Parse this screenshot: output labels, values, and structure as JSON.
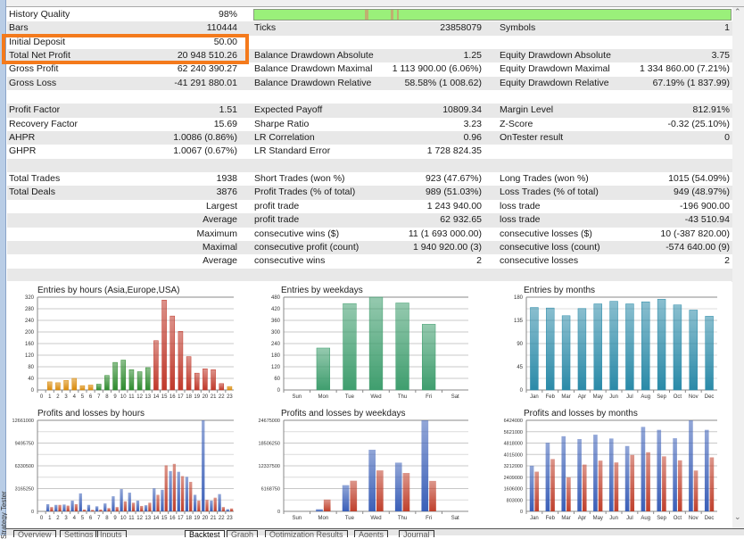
{
  "sidebar_tab": "Strategy Tester",
  "history_quality_bar": {
    "fill_percent": 98,
    "color": "#9af07a"
  },
  "stats": [
    [
      [
        "History Quality",
        "98%"
      ],
      [
        "",
        ""
      ],
      [
        "",
        ""
      ]
    ],
    [
      [
        "Bars",
        "110444"
      ],
      [
        "Ticks",
        "23858079"
      ],
      [
        "Symbols",
        "1"
      ]
    ],
    [
      [
        "Initial Deposit",
        "50.00"
      ],
      [
        "",
        ""
      ],
      [
        "",
        ""
      ]
    ],
    [
      [
        "Total Net Profit",
        "20 948 510.26"
      ],
      [
        "Balance Drawdown Absolute",
        "1.25"
      ],
      [
        "Equity Drawdown Absolute",
        "3.75"
      ]
    ],
    [
      [
        "Gross Profit",
        "62 240 390.27"
      ],
      [
        "Balance Drawdown Maximal",
        "1 113 900.00 (6.06%)"
      ],
      [
        "Equity Drawdown Maximal",
        "1 334 860.00 (7.21%)"
      ]
    ],
    [
      [
        "Gross Loss",
        "-41 291 880.01"
      ],
      [
        "Balance Drawdown Relative",
        "58.58% (1 008.62)"
      ],
      [
        "Equity Drawdown Relative",
        "67.19% (1 837.99)"
      ]
    ],
    [
      [
        "",
        ""
      ],
      [
        "",
        ""
      ],
      [
        "",
        ""
      ]
    ],
    [
      [
        "Profit Factor",
        "1.51"
      ],
      [
        "Expected Payoff",
        "10809.34"
      ],
      [
        "Margin Level",
        "812.91%"
      ]
    ],
    [
      [
        "Recovery Factor",
        "15.69"
      ],
      [
        "Sharpe Ratio",
        "3.23"
      ],
      [
        "Z-Score",
        "-0.32 (25.10%)"
      ]
    ],
    [
      [
        "AHPR",
        "1.0086 (0.86%)"
      ],
      [
        "LR Correlation",
        "0.96"
      ],
      [
        "OnTester result",
        "0"
      ]
    ],
    [
      [
        "GHPR",
        "1.0067 (0.67%)"
      ],
      [
        "LR Standard Error",
        "1 728 824.35"
      ],
      [
        "",
        ""
      ]
    ],
    [
      [
        "",
        ""
      ],
      [
        "",
        ""
      ],
      [
        "",
        ""
      ]
    ],
    [
      [
        "Total Trades",
        "1938"
      ],
      [
        "Short Trades (won %)",
        "923 (47.67%)"
      ],
      [
        "Long Trades (won %)",
        "1015 (54.09%)"
      ]
    ],
    [
      [
        "Total Deals",
        "3876"
      ],
      [
        "Profit Trades (% of total)",
        "989 (51.03%)"
      ],
      [
        "Loss Trades (% of total)",
        "949 (48.97%)"
      ]
    ],
    [
      [
        "",
        "Largest"
      ],
      [
        "profit trade",
        "1 243 940.00"
      ],
      [
        "loss trade",
        "-196 900.00"
      ]
    ],
    [
      [
        "",
        "Average"
      ],
      [
        "profit trade",
        "62 932.65"
      ],
      [
        "loss trade",
        "-43 510.94"
      ]
    ],
    [
      [
        "",
        "Maximum"
      ],
      [
        "consecutive wins ($)",
        "11 (1 693 000.00)"
      ],
      [
        "consecutive losses ($)",
        "10 (-387 820.00)"
      ]
    ],
    [
      [
        "",
        "Maximal"
      ],
      [
        "consecutive profit (count)",
        "1 940 920.00 (3)"
      ],
      [
        "consecutive loss (count)",
        "-574 640.00 (9)"
      ]
    ],
    [
      [
        "",
        "Average"
      ],
      [
        "consecutive wins",
        "2"
      ],
      [
        "consecutive losses",
        "2"
      ]
    ],
    [
      [
        "",
        ""
      ],
      [
        "",
        ""
      ],
      [
        "",
        ""
      ]
    ]
  ],
  "highlight_color": "#f47a1c",
  "bottom_tabs": [
    "Overview",
    "Settings",
    "Inputs",
    "Backtest",
    "Graph",
    "Optimization Results",
    "Agents",
    "Journal"
  ],
  "active_tab": "Backtest",
  "chart_data": [
    {
      "type": "bar",
      "title": "Entries by hours (Asia,Europe,USA)",
      "categories": [
        "0",
        "1",
        "2",
        "3",
        "4",
        "5",
        "6",
        "7",
        "8",
        "9",
        "10",
        "11",
        "12",
        "13",
        "14",
        "15",
        "16",
        "17",
        "18",
        "19",
        "20",
        "21",
        "22",
        "23"
      ],
      "values": [
        0,
        28,
        25,
        33,
        40,
        15,
        17,
        20,
        50,
        95,
        103,
        70,
        63,
        77,
        170,
        310,
        255,
        202,
        115,
        58,
        73,
        70,
        22,
        12
      ],
      "bar_colors": [
        "#d98a0a",
        "#d98a0a",
        "#d98a0a",
        "#d98a0a",
        "#d98a0a",
        "#d98a0a",
        "#d98a0a",
        "#2e8b2e",
        "#2e8b2e",
        "#2e8b2e",
        "#2e8b2e",
        "#2e8b2e",
        "#2e8b2e",
        "#2e8b2e",
        "#c0392b",
        "#c0392b",
        "#c0392b",
        "#c0392b",
        "#c0392b",
        "#c0392b",
        "#c0392b",
        "#c0392b",
        "#c0392b",
        "#d98a0a"
      ],
      "yticks": [
        0,
        40,
        80,
        120,
        160,
        200,
        240,
        280,
        320
      ],
      "ylim": [
        0,
        320
      ],
      "grid": true
    },
    {
      "type": "bar",
      "title": "Entries by weekdays",
      "categories": [
        "Sun",
        "Mon",
        "Tue",
        "Wed",
        "Thu",
        "Fri",
        "Sat"
      ],
      "values": [
        0,
        217,
        447,
        480,
        450,
        340,
        0
      ],
      "bar_colors": [
        "#3f9e6e"
      ],
      "yticks": [
        0,
        60,
        120,
        180,
        240,
        300,
        360,
        420,
        480
      ],
      "ylim": [
        0,
        480
      ],
      "grid": true
    },
    {
      "type": "bar",
      "title": "Entries by months",
      "categories": [
        "Jan",
        "Feb",
        "Mar",
        "Apr",
        "May",
        "Jun",
        "Jul",
        "Aug",
        "Sep",
        "Oct",
        "Nov",
        "Dec"
      ],
      "values": [
        160,
        159,
        144,
        158,
        167,
        172,
        167,
        171,
        176,
        165,
        155,
        143
      ],
      "bar_colors": [
        "#2a8aa8"
      ],
      "yticks": [
        0,
        45,
        90,
        135,
        180
      ],
      "ylim": [
        0,
        180
      ],
      "grid": true
    },
    {
      "type": "bar",
      "title": "Profits and losses by hours",
      "categories": [
        "0",
        "1",
        "2",
        "3",
        "4",
        "5",
        "6",
        "7",
        "8",
        "9",
        "10",
        "11",
        "12",
        "13",
        "14",
        "15",
        "16",
        "17",
        "18",
        "19",
        "20",
        "21",
        "22",
        "23"
      ],
      "series": [
        {
          "values": [
            0,
            1000000,
            900000,
            950000,
            1500000,
            2500000,
            900000,
            700000,
            1100000,
            2100000,
            3100000,
            2600000,
            1500000,
            850000,
            3200000,
            3000000,
            5600000,
            5500000,
            4800000,
            2300000,
            12661000,
            1500000,
            2400000,
            300000
          ],
          "color": "#3a5fb8"
        },
        {
          "values": [
            0,
            600000,
            900000,
            800000,
            1000000,
            250000,
            200000,
            250000,
            450000,
            600000,
            1400000,
            1200000,
            750000,
            1200000,
            2300000,
            6400000,
            6600000,
            4900000,
            4100000,
            1500000,
            1600000,
            1900000,
            600000,
            400000
          ],
          "color": "#c0402c"
        }
      ],
      "yticks": [
        0,
        3165250,
        6330500,
        9495750,
        12661000
      ],
      "ylim": [
        0,
        12661000
      ],
      "grid": true
    },
    {
      "type": "bar",
      "title": "Profits and losses by weekdays",
      "categories": [
        "Sun",
        "Mon",
        "Tue",
        "Wed",
        "Thu",
        "Fri",
        "Sat"
      ],
      "series": [
        {
          "values": [
            0,
            570000,
            7100000,
            16700000,
            13200000,
            24675000,
            0
          ],
          "color": "#3a5fb8"
        },
        {
          "values": [
            0,
            3200000,
            8300000,
            11100000,
            10400000,
            8250000,
            0
          ],
          "color": "#c0402c"
        }
      ],
      "yticks": [
        0,
        6168750,
        12337500,
        18506250,
        24675000
      ],
      "ylim": [
        0,
        24675000
      ],
      "grid": true
    },
    {
      "type": "bar",
      "title": "Profits and losses by months",
      "categories": [
        "Jan",
        "Feb",
        "Mar",
        "Apr",
        "May",
        "Jun",
        "Jul",
        "Aug",
        "Sep",
        "Oct",
        "Nov",
        "Dec"
      ],
      "series": [
        {
          "values": [
            3220000,
            4840000,
            5300000,
            5100000,
            5410000,
            5140000,
            4610000,
            5960000,
            5750000,
            5160000,
            6424000,
            5750000
          ],
          "color": "#3a5fb8"
        },
        {
          "values": [
            2800000,
            3690000,
            2400000,
            3300000,
            3580000,
            3450000,
            3980000,
            4170000,
            3880000,
            3600000,
            2880000,
            3810000
          ],
          "color": "#c0402c"
        }
      ],
      "yticks": [
        0,
        803000,
        1606000,
        2409000,
        3212000,
        4015000,
        4818000,
        5621000,
        6424000
      ],
      "ylim": [
        0,
        6424000
      ],
      "grid": true
    }
  ]
}
